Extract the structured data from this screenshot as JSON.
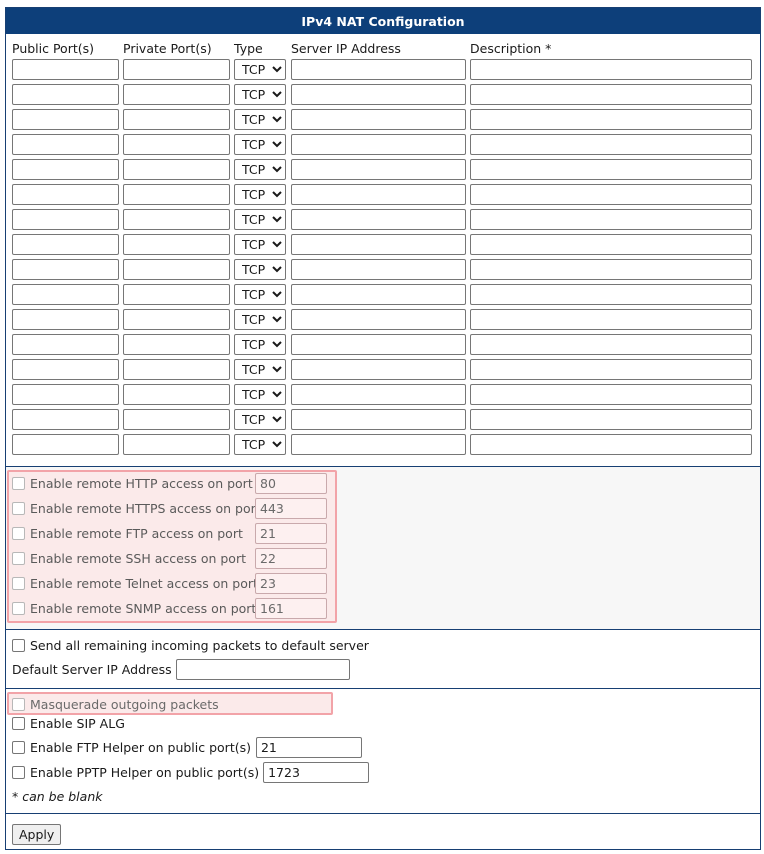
{
  "title": "IPv4 NAT Configuration",
  "columns": {
    "public_port": "Public Port(s)",
    "private_port": "Private Port(s)",
    "type": "Type",
    "server_ip": "Server IP Address",
    "description": "Description *"
  },
  "nat_rows": [
    {
      "public": "",
      "private": "",
      "type": "TCP",
      "server_ip": "",
      "description": ""
    },
    {
      "public": "",
      "private": "",
      "type": "TCP",
      "server_ip": "",
      "description": ""
    },
    {
      "public": "",
      "private": "",
      "type": "TCP",
      "server_ip": "",
      "description": ""
    },
    {
      "public": "",
      "private": "",
      "type": "TCP",
      "server_ip": "",
      "description": ""
    },
    {
      "public": "",
      "private": "",
      "type": "TCP",
      "server_ip": "",
      "description": ""
    },
    {
      "public": "",
      "private": "",
      "type": "TCP",
      "server_ip": "",
      "description": ""
    },
    {
      "public": "",
      "private": "",
      "type": "TCP",
      "server_ip": "",
      "description": ""
    },
    {
      "public": "",
      "private": "",
      "type": "TCP",
      "server_ip": "",
      "description": ""
    },
    {
      "public": "",
      "private": "",
      "type": "TCP",
      "server_ip": "",
      "description": ""
    },
    {
      "public": "",
      "private": "",
      "type": "TCP",
      "server_ip": "",
      "description": ""
    },
    {
      "public": "",
      "private": "",
      "type": "TCP",
      "server_ip": "",
      "description": ""
    },
    {
      "public": "",
      "private": "",
      "type": "TCP",
      "server_ip": "",
      "description": ""
    },
    {
      "public": "",
      "private": "",
      "type": "TCP",
      "server_ip": "",
      "description": ""
    },
    {
      "public": "",
      "private": "",
      "type": "TCP",
      "server_ip": "",
      "description": ""
    },
    {
      "public": "",
      "private": "",
      "type": "TCP",
      "server_ip": "",
      "description": ""
    },
    {
      "public": "",
      "private": "",
      "type": "TCP",
      "server_ip": "",
      "description": ""
    }
  ],
  "remote_access": [
    {
      "label": "Enable remote HTTP access on port",
      "port": "80",
      "checked": false
    },
    {
      "label": "Enable remote HTTPS access on port",
      "port": "443",
      "checked": false
    },
    {
      "label": "Enable remote FTP access on port",
      "port": "21",
      "checked": false
    },
    {
      "label": "Enable remote SSH access on port",
      "port": "22",
      "checked": false
    },
    {
      "label": "Enable remote Telnet access on port",
      "port": "23",
      "checked": false
    },
    {
      "label": "Enable remote SNMP access on port",
      "port": "161",
      "checked": false
    }
  ],
  "default_server": {
    "send_label": "Send all remaining incoming packets to default server",
    "ip_label": "Default Server IP Address",
    "ip_value": ""
  },
  "options": {
    "masquerade_label": "Masquerade outgoing packets",
    "sip_alg_label": "Enable SIP ALG",
    "ftp_helper_label": "Enable FTP Helper on public port(s)",
    "ftp_helper_value": "21",
    "pptp_helper_label": "Enable PPTP Helper on public port(s)",
    "pptp_helper_value": "1723",
    "note": "* can be blank"
  },
  "apply_label": "Apply",
  "colors": {
    "title_bg": "#0d3f7a",
    "highlight_border": "#f2a3a8",
    "highlight_bg": "#fbeaea"
  }
}
